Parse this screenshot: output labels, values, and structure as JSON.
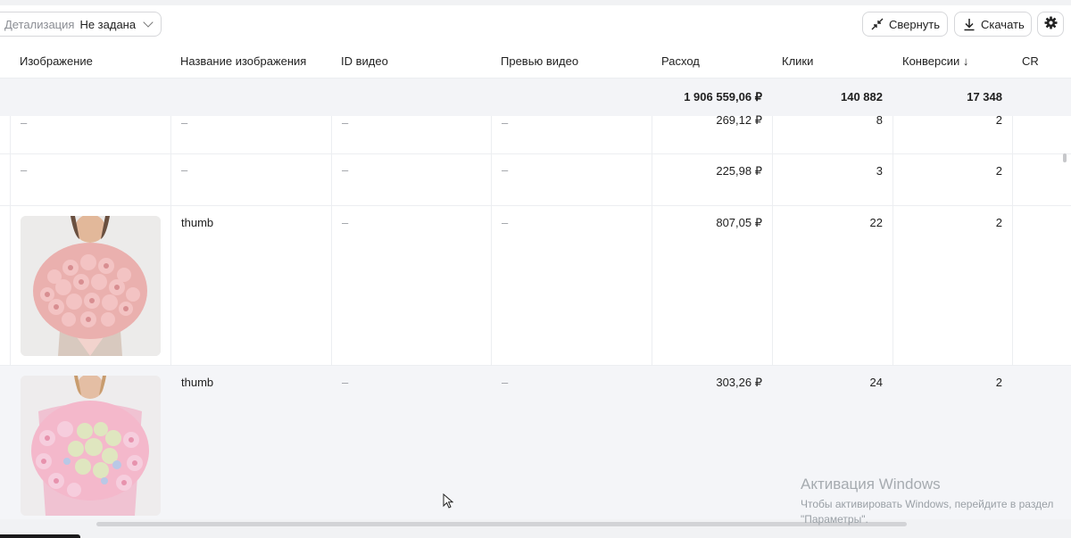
{
  "toolbar": {
    "detail_label": "Детализация",
    "detail_value": "Не задана",
    "collapse_label": "Свернуть",
    "download_label": "Скачать"
  },
  "columns": [
    "Изображение",
    "Название изображения",
    "ID видео",
    "Превью видео",
    "Расход",
    "Клики",
    "Конверсии ↓",
    "CR"
  ],
  "totals": {
    "spend": "1 906 559,06 ₽",
    "clicks": "140 882",
    "conversions": "17 348"
  },
  "rows": [
    {
      "image": "–",
      "name": "–",
      "video_id": "–",
      "video_preview": "–",
      "spend": "269,12 ₽",
      "clicks": "8",
      "conversions": "2"
    },
    {
      "image": "–",
      "name": "–",
      "video_id": "–",
      "video_preview": "–",
      "spend": "225,98 ₽",
      "clicks": "3",
      "conversions": "2"
    },
    {
      "image": "pink-roses-bouquet",
      "name": "thumb",
      "video_id": "–",
      "video_preview": "–",
      "spend": "807,05 ₽",
      "clicks": "22",
      "conversions": "2"
    },
    {
      "image": "pink-roses-hydrangea-bouquet",
      "name": "thumb",
      "video_id": "–",
      "video_preview": "–",
      "spend": "303,26 ₽",
      "clicks": "24",
      "conversions": "2"
    }
  ],
  "watermark": {
    "title": "Активация Windows",
    "line1": "Чтобы активировать Windows, перейдите в раздел",
    "line2": "\"Параметры\"."
  },
  "colors": {
    "header_bg": "#ffffff",
    "totals_bg": "#f3f4f7",
    "highlight_row": "#f4f5f8",
    "border": "#eceef1",
    "muted": "#9a9da3"
  }
}
